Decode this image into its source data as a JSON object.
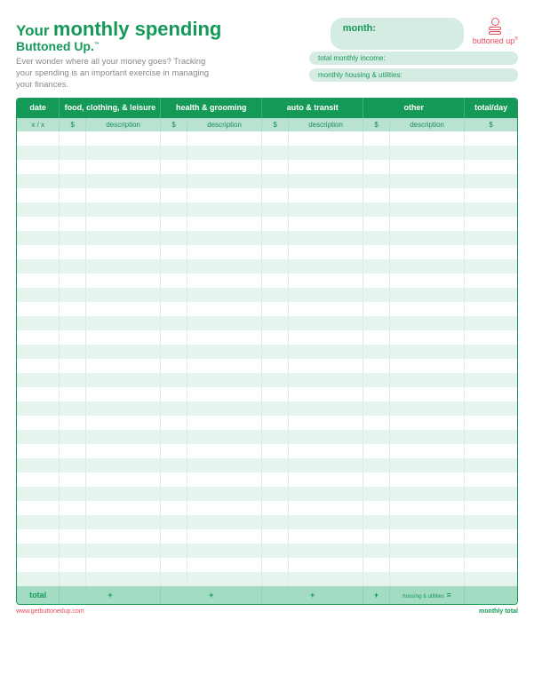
{
  "title": {
    "your": "Your",
    "main": "monthly spending",
    "sub": "Buttoned Up.",
    "tm": "™"
  },
  "intro": "Ever wonder where all your money goes? Tracking your spending is an important exercise in managing your finances.",
  "month_label": "month:",
  "pill_income": "total monthly income:",
  "pill_housing": "monthly housing & utilities:",
  "logo_text": "buttoned up",
  "headers": {
    "date": "date",
    "cat1": "food, clothing, & leisure",
    "cat2": "health & grooming",
    "cat3": "auto & transit",
    "cat4": "other",
    "total": "total/day"
  },
  "subheaders": {
    "date": "x / x",
    "amt": "$",
    "desc": "description"
  },
  "rows": 32,
  "footer": {
    "total": "total",
    "plus": "+",
    "housing": "housing & utilities",
    "eq": "=",
    "monthly_total": "monthly total"
  },
  "url": "www.getbuttonedup.com"
}
